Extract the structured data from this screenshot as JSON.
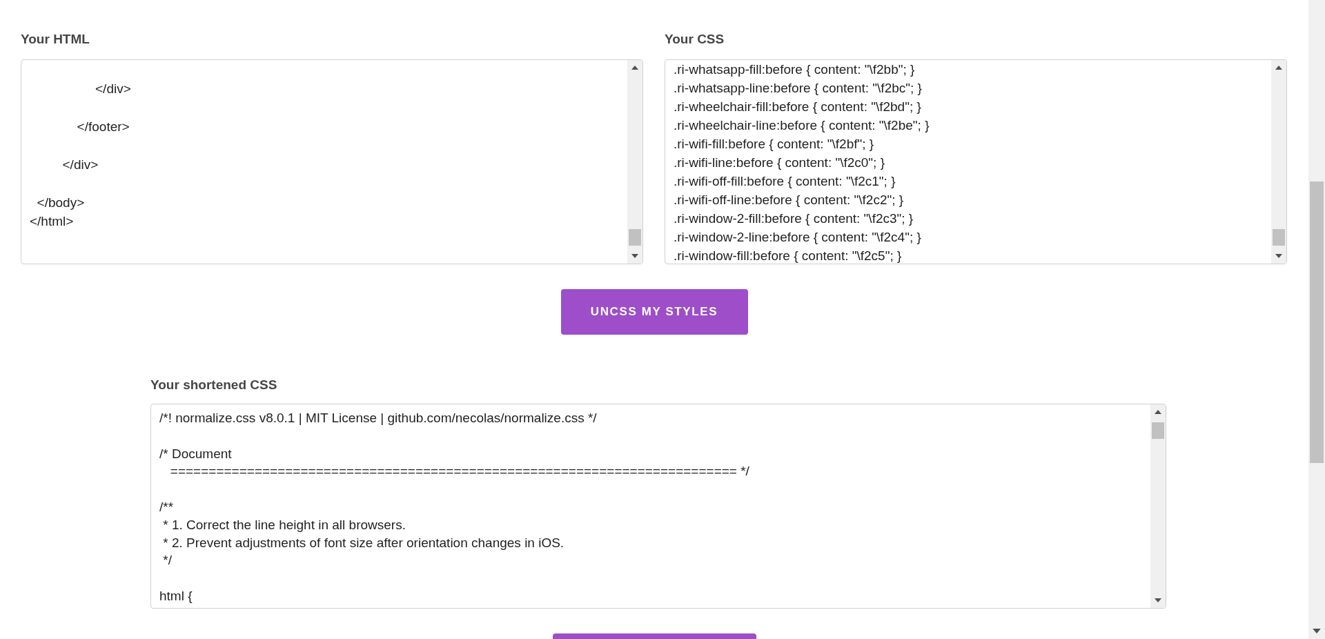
{
  "html_panel": {
    "label": "Your HTML",
    "value": "\n                  </div>\n\n             </footer>\n\n         </div>\n\n  </body>\n</html>"
  },
  "css_panel": {
    "label": "Your CSS",
    "lines": [
      ".ri-whatsapp-fill:before { content: \"\\f2bb\"; }",
      ".ri-whatsapp-line:before { content: \"\\f2bc\"; }",
      ".ri-wheelchair-fill:before { content: \"\\f2bd\"; }",
      ".ri-wheelchair-line:before { content: \"\\f2be\"; }",
      ".ri-wifi-fill:before { content: \"\\f2bf\"; }",
      ".ri-wifi-line:before { content: \"\\f2c0\"; }",
      ".ri-wifi-off-fill:before { content: \"\\f2c1\"; }",
      ".ri-wifi-off-line:before { content: \"\\f2c2\"; }",
      ".ri-window-2-fill:before { content: \"\\f2c3\"; }",
      ".ri-window-2-line:before { content: \"\\f2c4\"; }",
      ".ri-window-fill:before { content: \"\\f2c5\"; }"
    ]
  },
  "uncss_button": {
    "label": "UNCSS MY STYLES"
  },
  "output_panel": {
    "label": "Your shortened CSS",
    "value": "/*! normalize.css v8.0.1 | MIT License | github.com/necolas/normalize.css */\n\n/* Document\n   ========================================================================== */\n\n/**\n * 1. Correct the line height in all browsers.\n * 2. Prevent adjustments of font size after orientation changes in iOS.\n */\n\nhtml {"
  }
}
